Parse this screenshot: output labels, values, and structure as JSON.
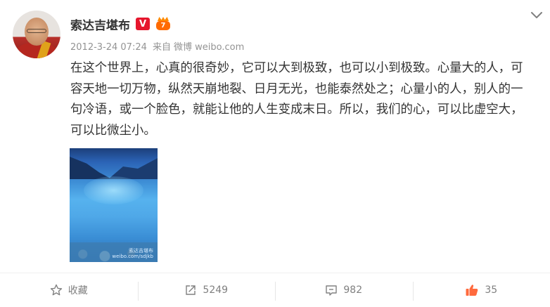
{
  "post": {
    "author": {
      "name": "索达吉堪布",
      "verified_badge": "V",
      "member_level": "7"
    },
    "meta": {
      "timestamp": "2012-3-24 07:24",
      "source_prefix": "来自",
      "source": "微博 weibo.com"
    },
    "text": "在这个世界上，心真的很奇妙，它可以大到极致，也可以小到极致。心量大的人，可容天地一切万物，纵然天崩地裂、日月无光，也能泰然处之；心量小的人，别人的一句冷语，或一个脸色，就能让他的人生变成末日。所以，我们的心，可以比虚空大，可以比微尘小。",
    "image": {
      "alt_icon": "lake-landscape-image",
      "watermark_line1": "索达吉堪布",
      "watermark_line2": "weibo.com/sdjkb"
    }
  },
  "toolbar": {
    "favorite_label": "收藏",
    "repost_count": "5249",
    "comment_count": "982",
    "like_count": "35"
  },
  "icons": {
    "menu": "chevron-down-icon",
    "favorite": "star-icon",
    "repost": "share-icon",
    "comment": "comment-icon",
    "like": "thumbs-up-icon"
  },
  "colors": {
    "verified": "#e6162d",
    "member": "#ff6a00",
    "like": "#ff6a3d",
    "meta_text": "#939393",
    "toolbar_text": "#808080"
  }
}
